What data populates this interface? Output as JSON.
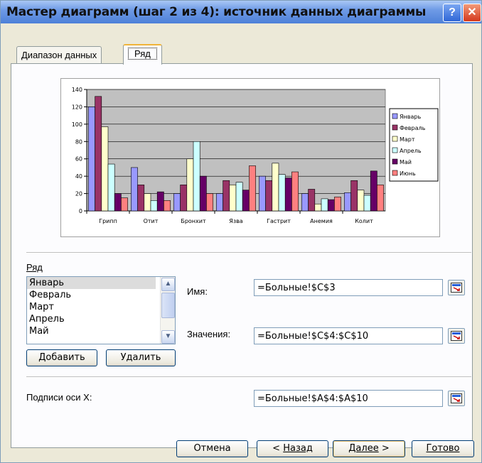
{
  "window": {
    "title": "Мастер диаграмм (шаг 2 из 4): источник данных диаграммы",
    "help_label": "?",
    "close_label": "✕"
  },
  "tabs": [
    {
      "label": "Диапазон данных"
    },
    {
      "label": "Ряд",
      "active": true
    }
  ],
  "chart_data": {
    "type": "bar",
    "categories": [
      "Грипп",
      "Отит",
      "Бронхит",
      "Язва",
      "Гастрит",
      "Анемия",
      "Колит"
    ],
    "ylim": [
      0,
      140
    ],
    "yticks": [
      "0",
      "20",
      "40",
      "60",
      "80",
      "100",
      "120",
      "140"
    ],
    "background": "#c0c0c0",
    "legend_position": "right",
    "series": [
      {
        "name": "Январь",
        "color": "#9999ff",
        "values": [
          120,
          50,
          20,
          20,
          40,
          20,
          21
        ]
      },
      {
        "name": "Февраль",
        "color": "#993366",
        "values": [
          132,
          30,
          30,
          35,
          35,
          25,
          35
        ]
      },
      {
        "name": "Март",
        "color": "#ffffcc",
        "values": [
          97,
          20,
          60,
          30,
          55,
          8,
          24
        ]
      },
      {
        "name": "Апрель",
        "color": "#ccffff",
        "values": [
          54,
          12,
          80,
          33,
          42,
          14,
          18
        ]
      },
      {
        "name": "Май",
        "color": "#660066",
        "values": [
          20,
          22,
          40,
          24,
          38,
          13,
          46
        ]
      },
      {
        "name": "Июнь",
        "color": "#ff8080",
        "values": [
          15,
          12,
          20,
          52,
          45,
          16,
          30
        ]
      }
    ]
  },
  "series_panel": {
    "heading": "Ряд",
    "items": [
      "Январь",
      "Февраль",
      "Март",
      "Апрель",
      "Май"
    ],
    "selected": "Январь",
    "add_label": "Добавить",
    "remove_label": "Удалить",
    "name_label": "Имя:",
    "name_value": "=Больные!$C$3",
    "values_label": "Значения:",
    "values_value": "=Больные!$C$4:$C$10"
  },
  "x_labels": {
    "label": "Подписи оси X:",
    "value": "=Больные!$A$4:$A$10"
  },
  "footer": {
    "cancel": "Отмена",
    "back": "< Назад",
    "next": "Далее >",
    "finish": "Готово"
  }
}
